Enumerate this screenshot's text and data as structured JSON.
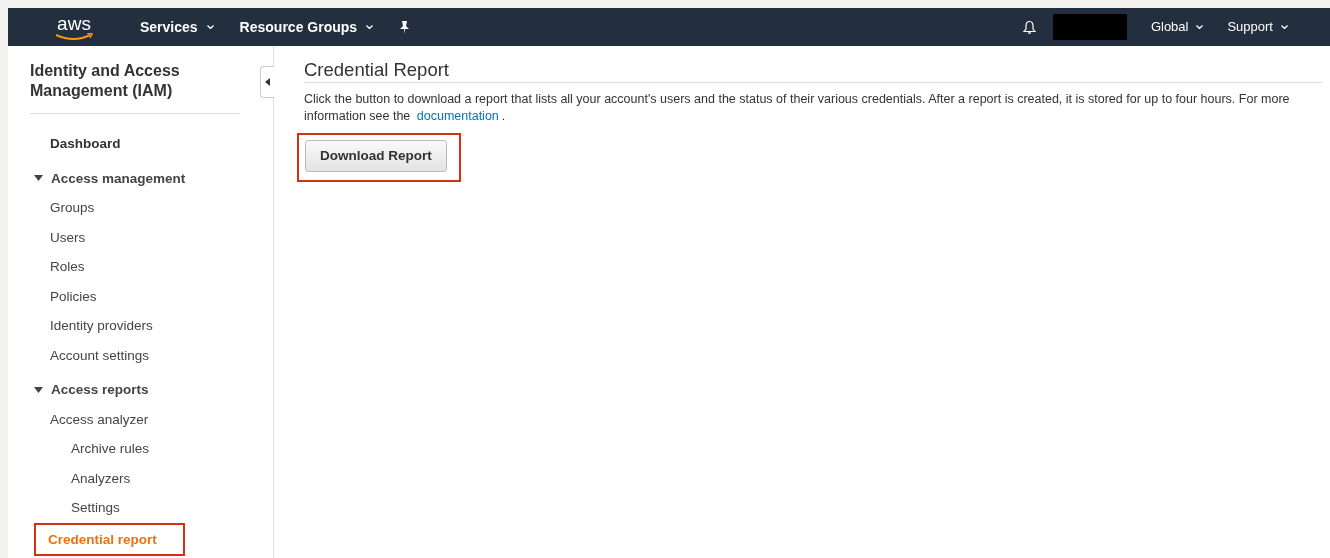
{
  "navbar": {
    "logo": "aws",
    "menus": [
      {
        "label": "Services"
      },
      {
        "label": "Resource Groups"
      }
    ],
    "right_menus": [
      {
        "label": "Global"
      },
      {
        "label": "Support"
      }
    ]
  },
  "sidebar": {
    "title": "Identity and Access Management (IAM)",
    "items": [
      {
        "label": "Dashboard",
        "kind": "link",
        "selected": false
      },
      {
        "label": "Access management",
        "kind": "section",
        "expanded": true,
        "children": [
          {
            "label": "Groups",
            "selected": false
          },
          {
            "label": "Users",
            "selected": false
          },
          {
            "label": "Roles",
            "selected": false
          },
          {
            "label": "Policies",
            "selected": false
          },
          {
            "label": "Identity providers",
            "selected": false
          },
          {
            "label": "Account settings",
            "selected": false
          }
        ]
      },
      {
        "label": "Access reports",
        "kind": "section",
        "expanded": true,
        "children": [
          {
            "label": "Access analyzer",
            "selected": false,
            "children": [
              {
                "label": "Archive rules",
                "selected": false
              },
              {
                "label": "Analyzers",
                "selected": false
              },
              {
                "label": "Settings",
                "selected": false
              }
            ]
          },
          {
            "label": "Credential report",
            "selected": true,
            "highlighted": true
          }
        ]
      }
    ]
  },
  "content": {
    "title": "Credential Report",
    "description": {
      "text": "Click the button to download a report that lists all your account's users and the status of their various credentials. After a report is created, it is stored for up to four hours. For more information see the ",
      "link": "documentation",
      "after": "."
    },
    "button": {
      "label": "Download Report",
      "highlighted": true
    }
  }
}
